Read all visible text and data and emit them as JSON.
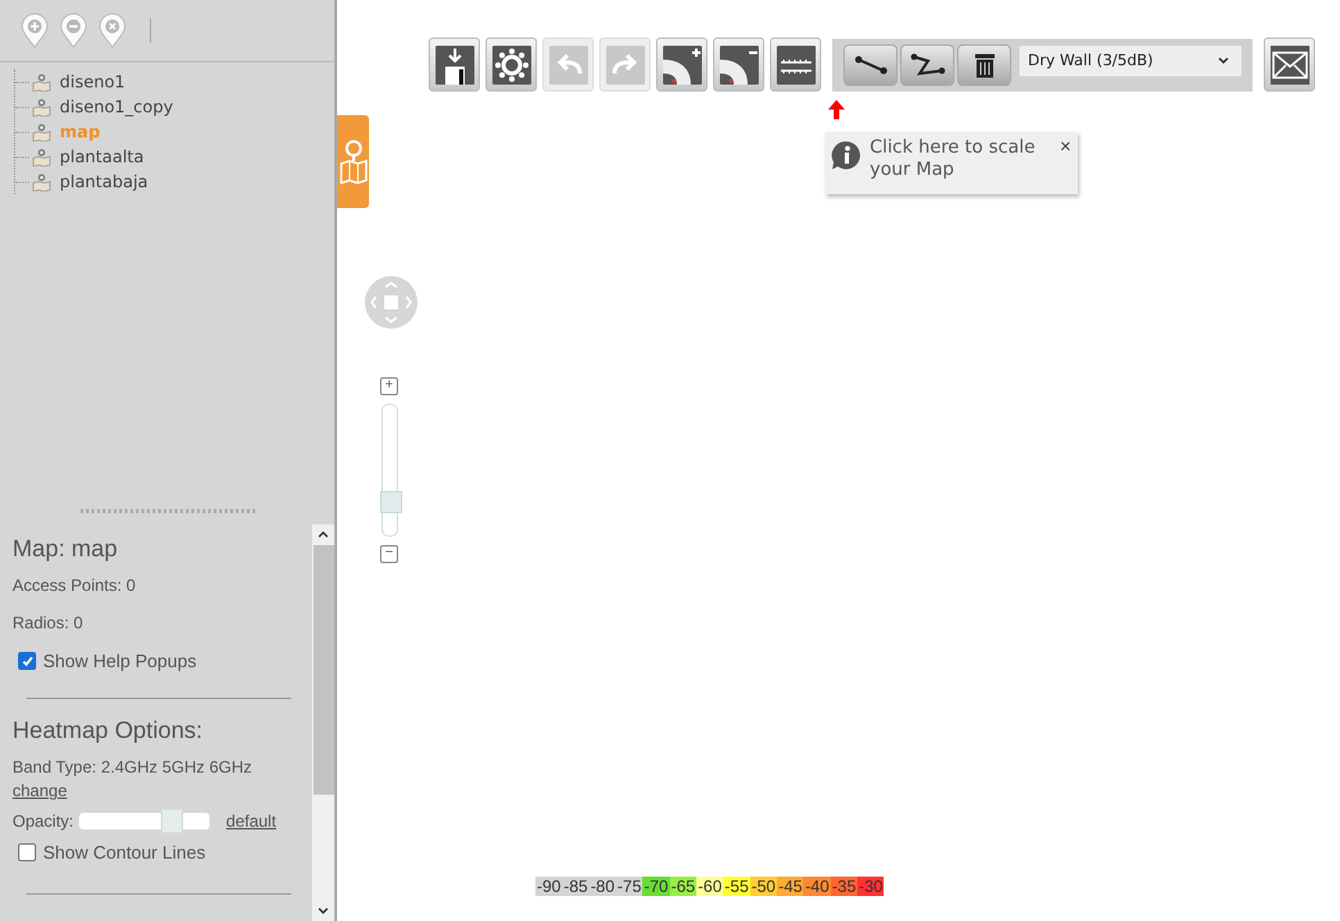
{
  "sidebar": {
    "maps": [
      {
        "label": "diseno1",
        "selected": false
      },
      {
        "label": "diseno1_copy",
        "selected": false
      },
      {
        "label": "map",
        "selected": true
      },
      {
        "label": "plantaalta",
        "selected": false
      },
      {
        "label": "plantabaja",
        "selected": false
      }
    ]
  },
  "info": {
    "title": "Map: map",
    "access_points": "Access Points: 0",
    "radios": "Radios: 0",
    "help_popups": {
      "label": "Show Help Popups",
      "checked": true
    }
  },
  "heatmap": {
    "title": "Heatmap Options:",
    "band_type": "Band Type: 2.4GHz 5GHz 6GHz",
    "change_link": "change",
    "opacity": {
      "label": "Opacity:",
      "level": 0.72
    },
    "default_link": "default",
    "contour": {
      "label": "Show Contour Lines",
      "checked": false
    }
  },
  "toolbar": {
    "buttons": [
      {
        "kind": "save",
        "disabled": false
      },
      {
        "kind": "settings",
        "disabled": false
      },
      {
        "kind": "undo",
        "disabled": true
      },
      {
        "kind": "redo",
        "disabled": true
      },
      {
        "kind": "add-gauge",
        "disabled": false
      },
      {
        "kind": "remove-gauge",
        "disabled": false
      },
      {
        "kind": "scale",
        "disabled": false
      }
    ],
    "wall_tools": [
      {
        "kind": "line"
      },
      {
        "kind": "polyline"
      },
      {
        "kind": "delete"
      }
    ],
    "wall_type": "Dry Wall (3/5dB)"
  },
  "tooltip": {
    "text": "Click here to scale your Map",
    "close": "×"
  },
  "zoom": {
    "plus": "+",
    "minus": "−",
    "level": 0.17
  },
  "legend": [
    {
      "label": "-90",
      "color": "#d4d4d4"
    },
    {
      "label": "-85",
      "color": "#d4d4d4"
    },
    {
      "label": "-80",
      "color": "#d4d4d4"
    },
    {
      "label": "-75",
      "color": "#d4d4d4"
    },
    {
      "label": "-70",
      "color": "#66dd33"
    },
    {
      "label": "-65",
      "color": "#99ee44"
    },
    {
      "label": "-60",
      "color": "#ffff99"
    },
    {
      "label": "-55",
      "color": "#ffff33"
    },
    {
      "label": "-50",
      "color": "#ffcc33"
    },
    {
      "label": "-45",
      "color": "#ffaa33"
    },
    {
      "label": "-40",
      "color": "#ff8833"
    },
    {
      "label": "-35",
      "color": "#ff6633"
    },
    {
      "label": "-30",
      "color": "#ff3333"
    }
  ]
}
